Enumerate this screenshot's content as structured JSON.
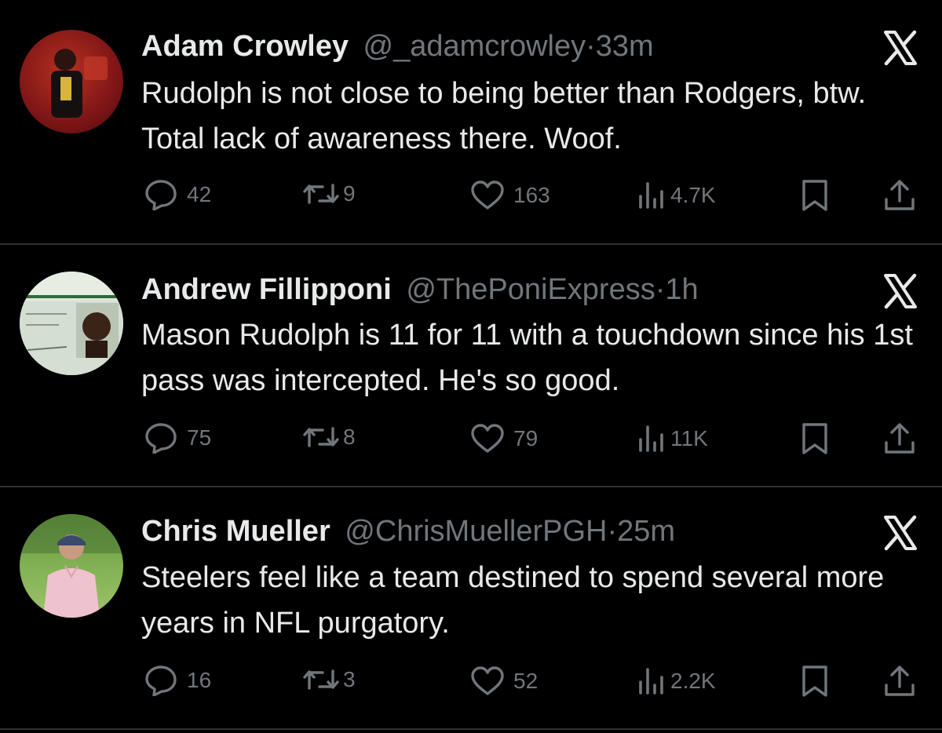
{
  "tweets": [
    {
      "name": "Adam Crowley",
      "handle": "@_adamcrowley",
      "time": "33m",
      "text": "Rudolph is not close to being better than Rodgers, btw. Total lack of awareness there. Woof.",
      "replies": "42",
      "reposts": "9",
      "likes": "163",
      "views": "4.7K",
      "avatar_colors": [
        "#8a1a1a",
        "#e0442a"
      ]
    },
    {
      "name": "Andrew Fillipponi",
      "handle": "@ThePoniExpress",
      "time": "1h",
      "text": "Mason Rudolph is 11 for 11 with a touchdown since his 1st pass was intercepted. He's so good.",
      "replies": "75",
      "reposts": "8",
      "likes": "79",
      "views": "11K",
      "avatar_colors": [
        "#dfe6dc",
        "#2e6b3a"
      ]
    },
    {
      "name": "Chris Mueller",
      "handle": "@ChrisMuellerPGH",
      "time": "25m",
      "text": "Steelers feel like a team destined to spend several more years in NFL purgatory.",
      "replies": "16",
      "reposts": "3",
      "likes": "52",
      "views": "2.2K",
      "avatar_colors": [
        "#6f9a4a",
        "#e8b7c4"
      ]
    }
  ],
  "icons": {
    "platform": "x-logo-icon",
    "reply": "reply-bubble-icon",
    "repost": "repost-arrows-icon",
    "like": "heart-icon",
    "views": "views-bars-icon",
    "bookmark": "bookmark-icon",
    "share": "share-upload-icon"
  },
  "colors": {
    "background": "#000000",
    "text": "#e7e9ea",
    "muted": "#71767b",
    "divider": "#2f3336"
  }
}
